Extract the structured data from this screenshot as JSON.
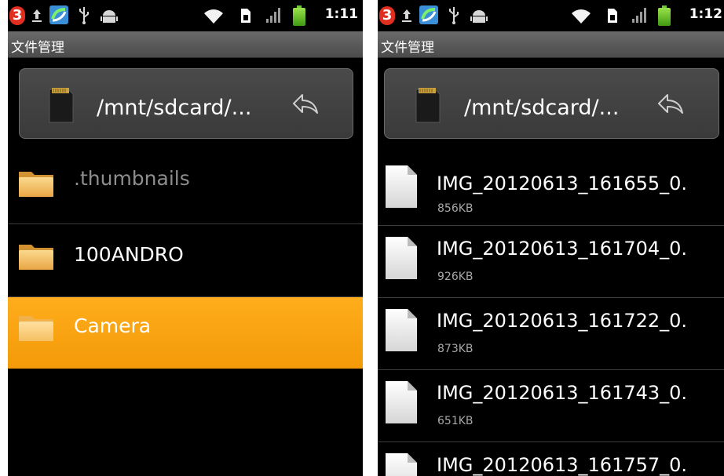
{
  "colors": {
    "selected_row": "#f8a010",
    "background": "#000000",
    "notification_badge": "#e02e20"
  },
  "left_screen": {
    "status_bar": {
      "notification_count": "3",
      "time": "1:11",
      "icons": [
        "notification-badge-icon",
        "upload-icon",
        "sync-app-icon",
        "usb-icon",
        "android-debug-icon",
        "wifi-icon",
        "sim-icon",
        "signal-icon",
        "battery-icon"
      ]
    },
    "app_title": "文件管理",
    "path": "/mnt/sdcard/...",
    "items": [
      {
        "name": ".thumbnails",
        "type": "folder",
        "hidden": true
      },
      {
        "name": "100ANDRO",
        "type": "folder"
      },
      {
        "name": "Camera",
        "type": "folder",
        "selected": true
      }
    ]
  },
  "right_screen": {
    "status_bar": {
      "notification_count": "3",
      "time": "1:12",
      "icons": [
        "notification-badge-icon",
        "upload-icon",
        "sync-app-icon",
        "usb-icon",
        "android-debug-icon",
        "wifi-icon",
        "sim-icon",
        "signal-icon",
        "battery-icon"
      ]
    },
    "app_title": "文件管理",
    "path": "/mnt/sdcard/...",
    "files": [
      {
        "name": "IMG_20120613_161655_0.",
        "size": "856KB"
      },
      {
        "name": "IMG_20120613_161704_0.",
        "size": "926KB"
      },
      {
        "name": "IMG_20120613_161722_0.",
        "size": "873KB"
      },
      {
        "name": "IMG_20120613_161743_0.",
        "size": "651KB"
      },
      {
        "name": "IMG_20120613_161757_0.",
        "size": ""
      }
    ]
  }
}
